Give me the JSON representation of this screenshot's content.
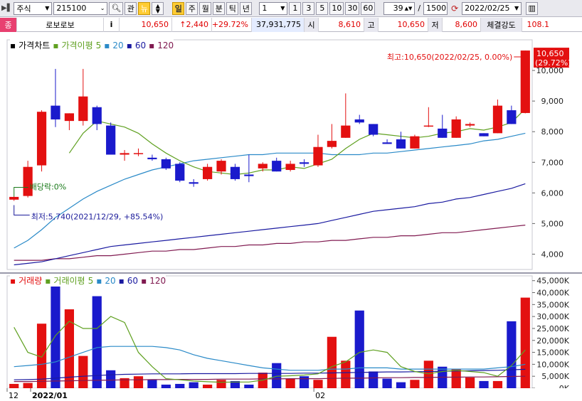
{
  "toolbar": {
    "market": "주식",
    "code": "215100",
    "btn_view": "관",
    "btn_news": "뉴",
    "periods": [
      "일",
      "주",
      "월",
      "분",
      "틱",
      "년"
    ],
    "interval_value": "1",
    "interval_presets": [
      "1",
      "3",
      "5",
      "10",
      "30",
      "60"
    ],
    "bars_shown": "39",
    "bars_total": "1500",
    "date": "2022/02/25"
  },
  "quote": {
    "tag": "종",
    "name": "로보로보",
    "info_btn": "i",
    "price": "10,650",
    "change": "↑2,440",
    "change_pct": "+29.72%",
    "volume": "37,931,775",
    "open_label": "시",
    "open": "8,610",
    "high_label": "고",
    "high": "10,650",
    "low_label": "저",
    "low": "8,600",
    "strength_label": "체결강도",
    "strength": "108.1"
  },
  "price_panel": {
    "label": "가격차트",
    "ma_label": "가격이평",
    "ma_periods": [
      "5",
      "20",
      "60",
      "120"
    ],
    "max_note": "최고:10,650(2022/02/25, 0.00%)",
    "min_note": "최저:5,740(2021/12/29, +85.54%)",
    "dividend_note": "배당락:0%",
    "last_price_tag": "10,650",
    "last_pct_tag": "(29.72%)"
  },
  "volume_panel": {
    "label": "거래량",
    "ma_label": "거래이평",
    "ma_periods": [
      "5",
      "20",
      "60",
      "120"
    ]
  },
  "xaxis": {
    "labels": [
      "12",
      "2022/01",
      "02"
    ]
  },
  "colors": {
    "up": "#e31010",
    "down": "#1a1acc",
    "ma5": "#5fa020",
    "ma20": "#2a8ac8",
    "ma60": "#1a1aa0",
    "ma120": "#801a50"
  },
  "chart_data": {
    "type": "candlestick",
    "price": {
      "ylim": [
        3500,
        11000
      ],
      "yticks": [
        4000,
        5000,
        6000,
        7000,
        8000,
        9000,
        10000
      ],
      "candles": [
        {
          "o": 5780,
          "h": 5880,
          "l": 5740,
          "c": 5870
        },
        {
          "o": 5900,
          "h": 7050,
          "l": 5850,
          "c": 6850
        },
        {
          "o": 6900,
          "h": 8700,
          "l": 6700,
          "c": 8650
        },
        {
          "o": 8850,
          "h": 10050,
          "l": 8150,
          "c": 8400
        },
        {
          "o": 8350,
          "h": 8600,
          "l": 8050,
          "c": 8600
        },
        {
          "o": 8350,
          "h": 10050,
          "l": 8200,
          "c": 9150
        },
        {
          "o": 8800,
          "h": 8850,
          "l": 8050,
          "c": 8250
        },
        {
          "o": 8200,
          "h": 8300,
          "l": 7250,
          "c": 7250
        },
        {
          "o": 7250,
          "h": 7400,
          "l": 7050,
          "c": 7300
        },
        {
          "o": 7300,
          "h": 7450,
          "l": 7200,
          "c": 7300
        },
        {
          "o": 7150,
          "h": 7250,
          "l": 7050,
          "c": 7100
        },
        {
          "o": 7100,
          "h": 7150,
          "l": 6750,
          "c": 6800
        },
        {
          "o": 6950,
          "h": 7000,
          "l": 6350,
          "c": 6400
        },
        {
          "o": 6350,
          "h": 6450,
          "l": 6200,
          "c": 6300
        },
        {
          "o": 6450,
          "h": 6950,
          "l": 6400,
          "c": 6850
        },
        {
          "o": 6700,
          "h": 7100,
          "l": 6600,
          "c": 7050
        },
        {
          "o": 6850,
          "h": 6950,
          "l": 6400,
          "c": 6450
        },
        {
          "o": 6600,
          "h": 7250,
          "l": 6350,
          "c": 6550
        },
        {
          "o": 6800,
          "h": 7000,
          "l": 6700,
          "c": 6950
        },
        {
          "o": 7050,
          "h": 7150,
          "l": 6700,
          "c": 6700
        },
        {
          "o": 6750,
          "h": 7050,
          "l": 6700,
          "c": 6950
        },
        {
          "o": 7000,
          "h": 7100,
          "l": 6850,
          "c": 6950
        },
        {
          "o": 6900,
          "h": 7900,
          "l": 6850,
          "c": 7500
        },
        {
          "o": 7500,
          "h": 8250,
          "l": 7450,
          "c": 7700
        },
        {
          "o": 7800,
          "h": 9250,
          "l": 7800,
          "c": 8200
        },
        {
          "o": 8400,
          "h": 8550,
          "l": 8250,
          "c": 8300
        },
        {
          "o": 8250,
          "h": 8250,
          "l": 7850,
          "c": 7900
        },
        {
          "o": 7650,
          "h": 7750,
          "l": 7600,
          "c": 7600
        },
        {
          "o": 7750,
          "h": 8000,
          "l": 7450,
          "c": 7450
        },
        {
          "o": 7450,
          "h": 7900,
          "l": 7450,
          "c": 7850
        },
        {
          "o": 8200,
          "h": 8800,
          "l": 8150,
          "c": 8200
        },
        {
          "o": 8100,
          "h": 8550,
          "l": 7800,
          "c": 7800
        },
        {
          "o": 7800,
          "h": 8500,
          "l": 7800,
          "c": 8400
        },
        {
          "o": 8200,
          "h": 8300,
          "l": 8150,
          "c": 8250
        },
        {
          "o": 7950,
          "h": 7950,
          "l": 7850,
          "c": 7850
        },
        {
          "o": 7950,
          "h": 9050,
          "l": 7950,
          "c": 8850
        },
        {
          "o": 8700,
          "h": 8850,
          "l": 8250,
          "c": 8250
        },
        {
          "o": 8610,
          "h": 10650,
          "l": 8600,
          "c": 10650
        }
      ],
      "ma5": [
        null,
        null,
        null,
        null,
        7300,
        7950,
        8350,
        8250,
        8150,
        7950,
        7600,
        7300,
        7050,
        6850,
        6700,
        6650,
        6600,
        6650,
        6750,
        6750,
        6850,
        6800,
        6950,
        7100,
        7450,
        7750,
        7950,
        7900,
        7850,
        7800,
        7850,
        7950,
        8000,
        8100,
        8050,
        8150,
        8300,
        8750
      ],
      "ma20": [
        4200,
        4450,
        4800,
        5200,
        5500,
        5800,
        6050,
        6250,
        6450,
        6600,
        6750,
        6850,
        6950,
        7050,
        7100,
        7150,
        7200,
        7250,
        7250,
        7300,
        7300,
        7300,
        7300,
        7250,
        7250,
        7250,
        7300,
        7300,
        7350,
        7400,
        7450,
        7500,
        7550,
        7600,
        7700,
        7750,
        7850,
        7950
      ],
      "ma60": [
        3650,
        3700,
        3750,
        3850,
        3950,
        4050,
        4150,
        4250,
        4300,
        4350,
        4400,
        4450,
        4500,
        4550,
        4600,
        4650,
        4700,
        4750,
        4800,
        4850,
        4900,
        4950,
        5000,
        5100,
        5200,
        5300,
        5400,
        5450,
        5500,
        5550,
        5650,
        5700,
        5800,
        5850,
        5950,
        6050,
        6150,
        6300
      ],
      "ma120": [
        3800,
        3800,
        3800,
        3850,
        3850,
        3900,
        3950,
        3950,
        4000,
        4050,
        4100,
        4100,
        4150,
        4150,
        4200,
        4250,
        4250,
        4300,
        4300,
        4350,
        4350,
        4400,
        4400,
        4450,
        4450,
        4500,
        4550,
        4550,
        4600,
        4600,
        4650,
        4700,
        4700,
        4750,
        4800,
        4850,
        4900,
        4950
      ]
    },
    "volume": {
      "ylim": [
        0,
        47000
      ],
      "yticks": [
        0,
        5000,
        10000,
        15000,
        20000,
        25000,
        30000,
        35000,
        40000,
        45000
      ],
      "ytick_labels": [
        "0K",
        "5,000K",
        "10,000K",
        "15,000K",
        "20,000K",
        "25,000K",
        "30,000K",
        "35,000K",
        "40,000K",
        "45,000K"
      ],
      "values": [
        1800,
        2200,
        27000,
        46000,
        33000,
        13500,
        38500,
        7500,
        4200,
        5000,
        3500,
        1500,
        1800,
        2500,
        1500,
        3500,
        3000,
        1500,
        6500,
        10500,
        4000,
        5000,
        3500,
        21500,
        11500,
        32500,
        7000,
        4000,
        2500,
        3500,
        11500,
        9000,
        8000,
        4500,
        3000,
        3000,
        28000,
        37900
      ],
      "ma5": [
        25500,
        15000,
        13000,
        22000,
        28000,
        25000,
        25000,
        30000,
        27500,
        15000,
        9000,
        4000,
        3500,
        3000,
        2700,
        2500,
        2600,
        2600,
        3400,
        5000,
        5200,
        5500,
        6000,
        9000,
        11000,
        15000,
        16000,
        15000,
        9000,
        7000,
        6000,
        7000,
        7500,
        7000,
        6500,
        5000,
        9500,
        16000
      ],
      "ma20": [
        9000,
        9500,
        10000,
        11000,
        13000,
        15000,
        17000,
        17500,
        17500,
        17500,
        17500,
        17000,
        16000,
        14000,
        12500,
        11500,
        10500,
        9500,
        8500,
        8000,
        7500,
        7500,
        7500,
        8000,
        8000,
        8500,
        8500,
        8500,
        8000,
        8000,
        8000,
        8000,
        8000,
        8000,
        8000,
        8500,
        9000,
        10000
      ],
      "ma60": [
        3500,
        3600,
        3800,
        4200,
        4600,
        5000,
        5300,
        5600,
        5800,
        5900,
        6000,
        6000,
        6000,
        6100,
        6100,
        6100,
        6100,
        6200,
        6200,
        6200,
        6200,
        6300,
        6300,
        6400,
        6500,
        6600,
        6700,
        6800,
        6800,
        6900,
        7000,
        7100,
        7200,
        7300,
        7400,
        7500,
        7700,
        7900
      ],
      "ma120": [
        2800,
        2800,
        2900,
        3000,
        3100,
        3200,
        3300,
        3400,
        3500,
        3500,
        3600,
        3600,
        3700,
        3700,
        3700,
        3800,
        3800,
        3800,
        3900,
        3900,
        4000,
        4000,
        4000,
        4100,
        4200,
        4200,
        4300,
        4400,
        4400,
        4500,
        4500,
        4600,
        4600,
        4700,
        4700,
        4800,
        4900,
        5000
      ]
    }
  }
}
